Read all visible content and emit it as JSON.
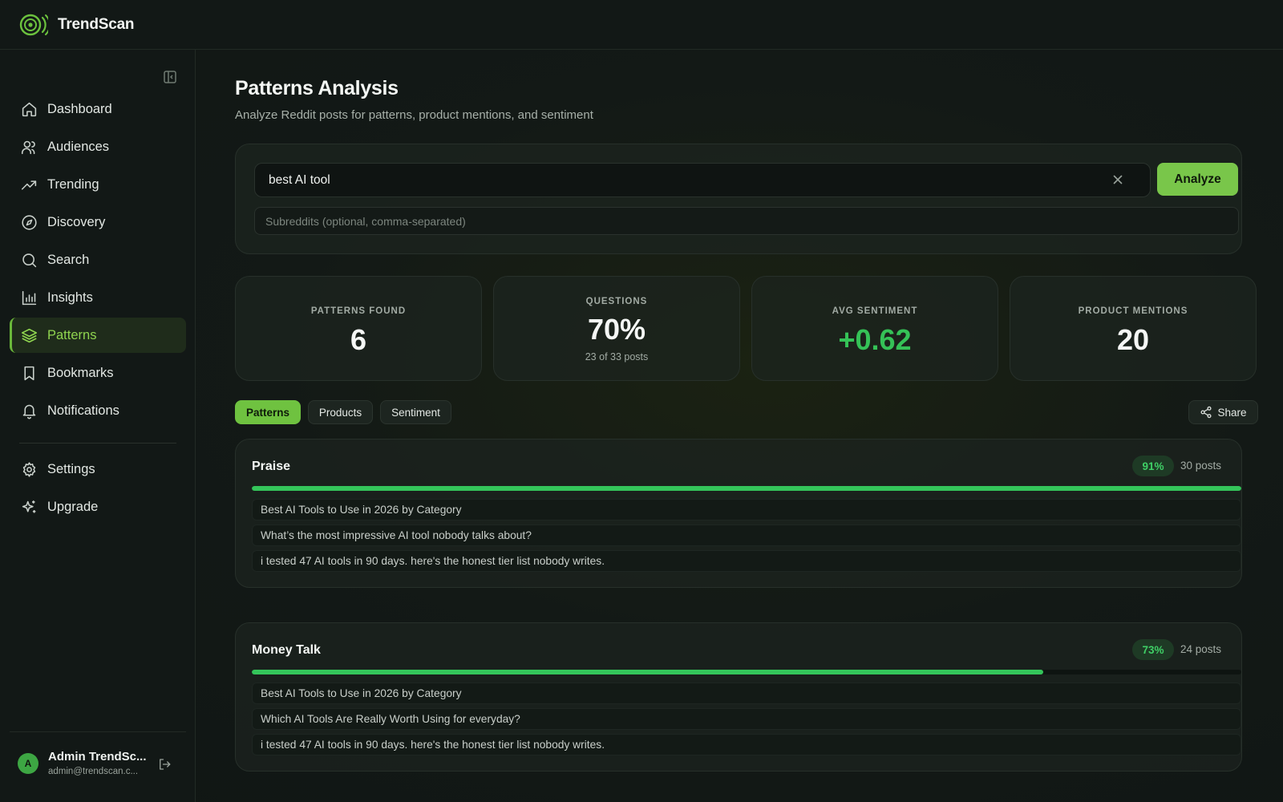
{
  "app": {
    "brand": "TrendScan",
    "accent": "#79c64a",
    "logo_icon": "radar-signal-icon"
  },
  "sidebar": {
    "items": [
      {
        "label": "Dashboard",
        "icon": "home-icon",
        "active": false
      },
      {
        "label": "Audiences",
        "icon": "users-icon",
        "active": false
      },
      {
        "label": "Trending",
        "icon": "trending-up-icon",
        "active": false
      },
      {
        "label": "Discovery",
        "icon": "compass-icon",
        "active": false
      },
      {
        "label": "Search",
        "icon": "search-icon",
        "active": false
      },
      {
        "label": "Insights",
        "icon": "bar-chart-icon",
        "active": false
      },
      {
        "label": "Patterns",
        "icon": "layers-icon",
        "active": true
      },
      {
        "label": "Bookmarks",
        "icon": "bookmark-icon",
        "active": false
      },
      {
        "label": "Notifications",
        "icon": "bell-icon",
        "active": false
      },
      {
        "label": "Settings",
        "icon": "gear-icon",
        "active": false
      },
      {
        "label": "Upgrade",
        "icon": "sparkles-icon",
        "active": false
      }
    ],
    "user": {
      "initial": "A",
      "name": "Admin TrendSc...",
      "email": "admin@trendscan.c..."
    }
  },
  "page": {
    "title": "Patterns Analysis",
    "subtitle": "Analyze Reddit posts for patterns, product mentions, and sentiment"
  },
  "search": {
    "query": "best AI tool",
    "analyze_label": "Analyze",
    "subreddits_placeholder": "Subreddits (optional, comma-separated)",
    "subreddits_value": ""
  },
  "stats": [
    {
      "label": "PATTERNS FOUND",
      "value": "6",
      "note": ""
    },
    {
      "label": "QUESTIONS",
      "value": "70%",
      "note": "23 of 33 posts"
    },
    {
      "label": "AVG SENTIMENT",
      "value": "+0.62",
      "note": "",
      "color": "#35c257"
    },
    {
      "label": "PRODUCT MENTIONS",
      "value": "20",
      "note": ""
    }
  ],
  "tabs": [
    {
      "label": "Patterns",
      "active": true
    },
    {
      "label": "Products",
      "active": false
    },
    {
      "label": "Sentiment",
      "active": false
    }
  ],
  "share_label": "Share",
  "patterns": [
    {
      "name": "Praise",
      "percent": "91%",
      "fill": 1.0,
      "posts": "30 posts",
      "examples": [
        "Best AI Tools to Use in 2026 by Category",
        "What’s the most impressive AI tool nobody talks about?",
        "i tested 47 AI tools in 90 days. here's the honest tier list nobody writes."
      ]
    },
    {
      "name": "Money Talk",
      "percent": "73%",
      "fill": 0.8,
      "posts": "24 posts",
      "examples": [
        "Best AI Tools to Use in 2026 by Category",
        "Which AI Tools Are Really Worth Using for everyday?",
        "i tested 47 AI tools in 90 days. here's the honest tier list nobody writes."
      ]
    }
  ]
}
